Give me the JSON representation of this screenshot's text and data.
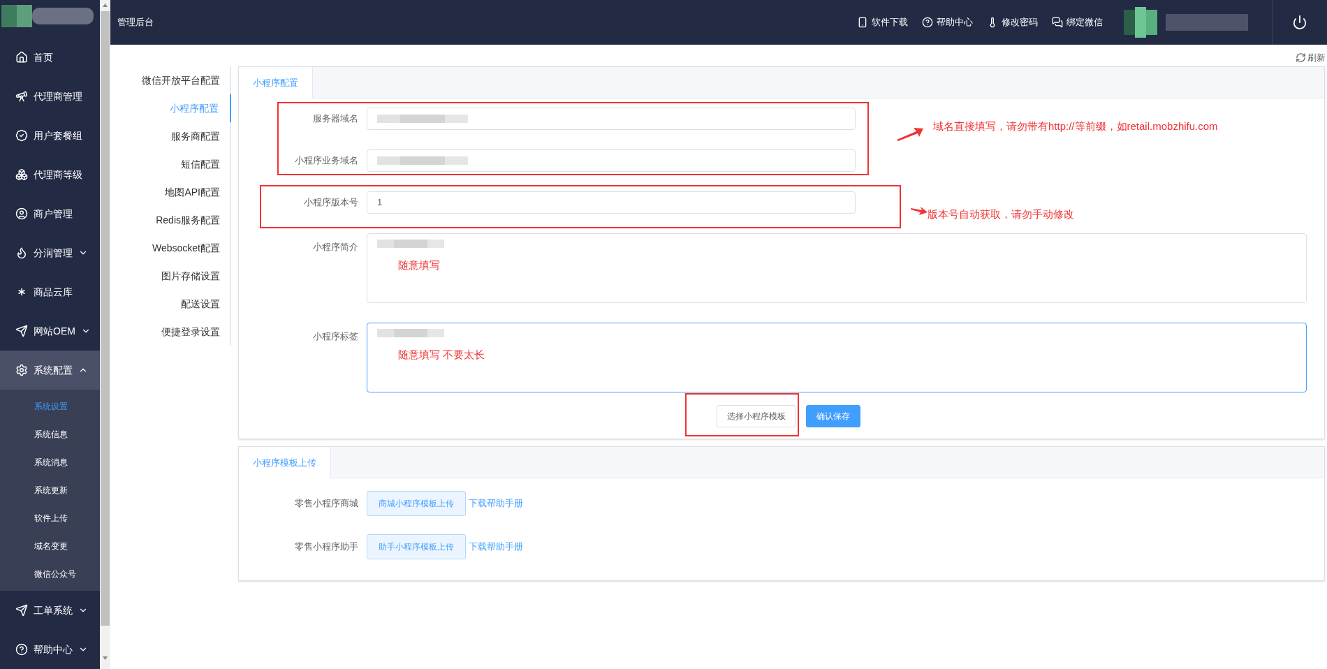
{
  "header": {
    "title": "管理后台",
    "actions": [
      {
        "label": "软件下载"
      },
      {
        "label": "帮助中心"
      },
      {
        "label": "修改密码"
      },
      {
        "label": "绑定微信"
      }
    ]
  },
  "sidebar": {
    "items": [
      {
        "label": "首页",
        "kind": "link"
      },
      {
        "label": "代理商管理",
        "kind": "link"
      },
      {
        "label": "用户套餐组",
        "kind": "link"
      },
      {
        "label": "代理商等级",
        "kind": "link"
      },
      {
        "label": "商户管理",
        "kind": "link"
      },
      {
        "label": "分润管理",
        "kind": "group",
        "expanded": false
      },
      {
        "label": "商品云库",
        "kind": "link"
      },
      {
        "label": "网站OEM",
        "kind": "group",
        "expanded": false
      },
      {
        "label": "系统配置",
        "kind": "group",
        "expanded": true,
        "children": [
          {
            "label": "系统设置",
            "selected": true
          },
          {
            "label": "系统信息",
            "selected": false
          },
          {
            "label": "系统消息",
            "selected": false
          },
          {
            "label": "系统更新",
            "selected": false
          },
          {
            "label": "软件上传",
            "selected": false
          },
          {
            "label": "域名变更",
            "selected": false
          },
          {
            "label": "微信公众号",
            "selected": false
          }
        ]
      },
      {
        "label": "工单系统",
        "kind": "group",
        "expanded": false
      },
      {
        "label": "帮助中心",
        "kind": "group",
        "expanded": false
      }
    ]
  },
  "refresh": "刷新",
  "config_menu": [
    {
      "label": "微信开放平台配置",
      "selected": false
    },
    {
      "label": "小程序配置",
      "selected": true
    },
    {
      "label": "服务商配置",
      "selected": false
    },
    {
      "label": "短信配置",
      "selected": false
    },
    {
      "label": "地图API配置",
      "selected": false
    },
    {
      "label": "Redis服务配置",
      "selected": false
    },
    {
      "label": "Websocket配置",
      "selected": false
    },
    {
      "label": "图片存储设置",
      "selected": false
    },
    {
      "label": "配送设置",
      "selected": false
    },
    {
      "label": "便捷登录设置",
      "selected": false
    }
  ],
  "config_panel": {
    "tab": {
      "label": "小程序配置",
      "selected": true
    },
    "fields": [
      {
        "label": "服务器域名",
        "kind": "input",
        "focused": false
      },
      {
        "label": "小程序业务域名",
        "kind": "input",
        "focused": false
      },
      {
        "label": "小程序版本号",
        "kind": "input",
        "value": "1",
        "focused": false
      },
      {
        "label": "小程序简介",
        "kind": "textarea",
        "focused": false,
        "note": "随意填写"
      },
      {
        "label": "小程序标签",
        "kind": "textarea",
        "focused": true,
        "note": "随意填写 不要太长"
      }
    ],
    "buttons": [
      {
        "label": "选择小程序模板",
        "kind": "default"
      },
      {
        "label": "确认保存",
        "kind": "primary"
      }
    ]
  },
  "annotations": [
    {
      "text": "域名直接填写，请勿带有http://等前缀，如retail.mobzhifu.com"
    },
    {
      "text": "版本号自动获取，请勿手动修改"
    }
  ],
  "upload_panel": {
    "tab": {
      "label": "小程序模板上传",
      "selected": true
    },
    "rows": [
      {
        "label": "零售小程序商城",
        "button": "商城小程序模板上传",
        "link": "下载帮助手册"
      },
      {
        "label": "零售小程序助手",
        "button": "助手小程序模板上传",
        "link": "下载帮助手册"
      }
    ]
  }
}
